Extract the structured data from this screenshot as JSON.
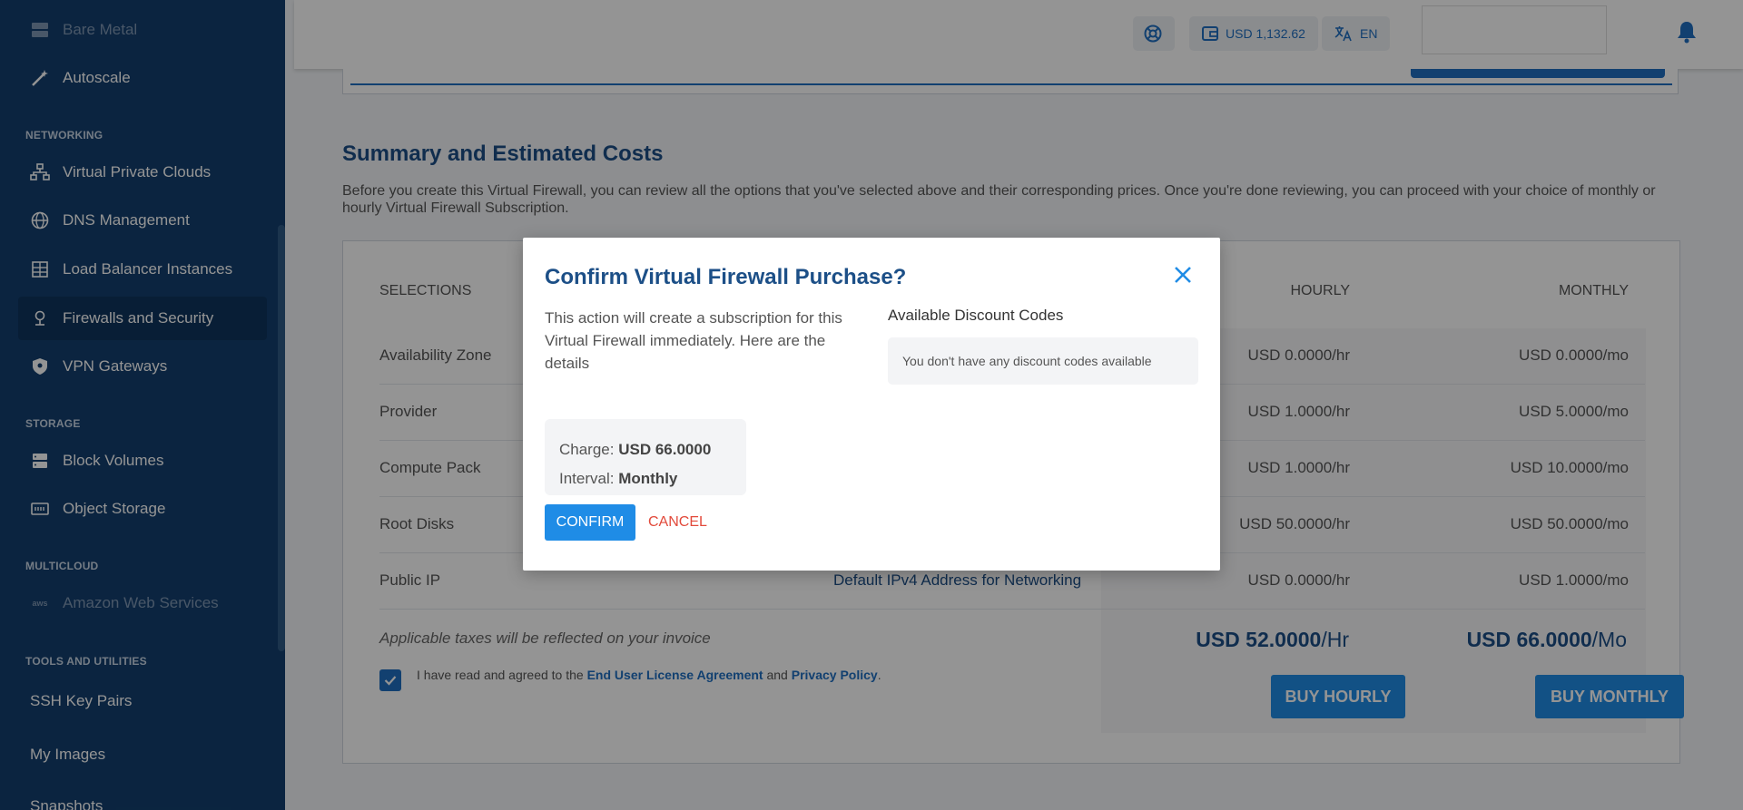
{
  "sidebar": {
    "items": [
      {
        "label": "Bare Metal",
        "icon": "server-icon"
      },
      {
        "label": "Autoscale",
        "icon": "magic-wand-icon"
      },
      {
        "label": "Virtual Private Clouds",
        "icon": "network-tree-icon"
      },
      {
        "label": "DNS Management",
        "icon": "globe-icon"
      },
      {
        "label": "Load Balancer Instances",
        "icon": "load-balancer-icon"
      },
      {
        "label": "Firewalls and Security",
        "icon": "firewall-icon"
      },
      {
        "label": "VPN Gateways",
        "icon": "shield-icon"
      },
      {
        "label": "Block Volumes",
        "icon": "block-volume-icon"
      },
      {
        "label": "Object Storage",
        "icon": "object-storage-icon"
      },
      {
        "label": "Amazon Web Services",
        "icon": "aws-icon"
      },
      {
        "label": "SSH Key Pairs"
      },
      {
        "label": "My Images"
      },
      {
        "label": "Snapshots"
      }
    ],
    "sections": {
      "networking": "NETWORKING",
      "storage": "STORAGE",
      "multicloud": "MULTICLOUD",
      "tools": "TOOLS AND UTILITIES"
    }
  },
  "topbar": {
    "balance": "USD 1,132.62",
    "language": "EN"
  },
  "summary": {
    "title": "Summary and Estimated Costs",
    "description": "Before you create this Virtual Firewall, you can review all the options that you've selected above and their corresponding prices. Once you're done reviewing, you can proceed with your choice of monthly or hourly Virtual Firewall Subscription.",
    "headers": {
      "selections": "SELECTIONS",
      "hourly": "HOURLY",
      "monthly": "MONTHLY"
    },
    "rows": [
      {
        "label": "Availability Zone",
        "value": "",
        "hourly": "USD 0.0000/hr",
        "monthly": "USD 0.0000/mo"
      },
      {
        "label": "Provider",
        "value": "",
        "hourly": "USD 1.0000/hr",
        "monthly": "USD 5.0000/mo"
      },
      {
        "label": "Compute Pack",
        "value": "",
        "hourly": "USD 1.0000/hr",
        "monthly": "USD 10.0000/mo"
      },
      {
        "label": "Root Disks",
        "value": "",
        "hourly": "USD 50.0000/hr",
        "monthly": "USD 50.0000/mo"
      },
      {
        "label": "Public IP",
        "value": "Default IPv4 Address for Networking",
        "hourly": "USD 0.0000/hr",
        "monthly": "USD 1.0000/mo"
      }
    ],
    "taxes_note": "Applicable taxes will be reflected on your invoice",
    "agree_text": "I have read and agreed to the",
    "eula_link": "End User License Agreement",
    "and_text": "and",
    "privacy_link": "Privacy Policy",
    "period": ".",
    "total_hourly_amount": "USD 52.0000",
    "total_hourly_unit": "/Hr",
    "total_monthly_amount": "USD 66.0000",
    "total_monthly_unit": "/Mo",
    "buy_hourly": "BUY HOURLY",
    "buy_monthly": "BUY MONTHLY"
  },
  "modal": {
    "title": "Confirm Virtual Firewall Purchase?",
    "description": "This action will create a subscription for this Virtual Firewall immediately. Here are the details",
    "discount_title": "Available Discount Codes",
    "discount_empty": "You don't have any discount codes available",
    "charge_label": "Charge:",
    "charge_value": "USD 66.0000",
    "interval_label": "Interval:",
    "interval_value": "Monthly",
    "confirm": "CONFIRM",
    "cancel": "CANCEL"
  },
  "colors": {
    "sidebar_bg": "#133f6e",
    "accent": "#1f8ce6",
    "title_blue": "#1c4f87",
    "cancel_red": "#e24a3b"
  }
}
